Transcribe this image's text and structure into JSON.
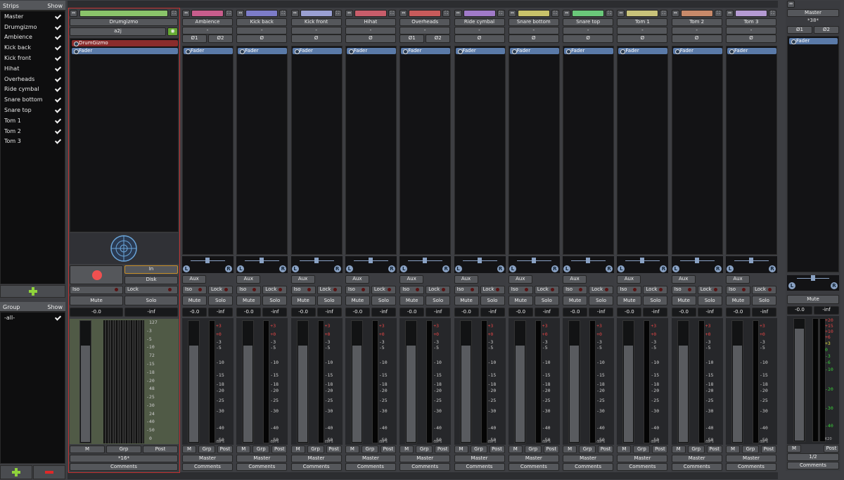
{
  "strips_panel": {
    "title": "Strips",
    "show_label": "Show",
    "items": [
      "Master",
      "Drumgizmo",
      "Ambience",
      "Kick back",
      "Kick front",
      "Hihat",
      "Overheads",
      "Ride cymbal",
      "Snare bottom",
      "Snare top",
      "Tom 1",
      "Tom 2",
      "Tom 3"
    ]
  },
  "group_panel": {
    "title": "Group",
    "show_label": "Show",
    "items": [
      "-all-"
    ]
  },
  "drumgizmo": {
    "name": "Drumgizmo",
    "input": "a2j",
    "plugins": [
      "DrumGizmo",
      "Fader"
    ],
    "in_label": "In",
    "disk_label": "Disk",
    "iso": "Iso",
    "lock": "Lock",
    "mute": "Mute",
    "solo": "Solo",
    "gain": "-0.0",
    "peak": "-inf",
    "m": "M",
    "grp": "Grp",
    "post": "Post",
    "output": "*16*",
    "comments": "Comments",
    "scale": [
      "127",
      "-3",
      "-5",
      "-10",
      "72",
      "-15",
      "-18",
      "-20",
      "48",
      "-25",
      "-30",
      "24",
      "-40",
      "-50",
      "0"
    ]
  },
  "strips": [
    {
      "name": "Ambience",
      "color": "#c85d8c",
      "phase": [
        "Ø1",
        "Ø2"
      ]
    },
    {
      "name": "Kick back",
      "color": "#7c7cc8",
      "phase": [
        "Ø"
      ]
    },
    {
      "name": "Kick front",
      "color": "#9aa0d2",
      "phase": [
        "Ø"
      ]
    },
    {
      "name": "Hihat",
      "color": "#c85d6a",
      "phase": [
        "Ø"
      ]
    },
    {
      "name": "Overheads",
      "color": "#c85b5b",
      "phase": [
        "Ø1",
        "Ø2"
      ]
    },
    {
      "name": "Ride cymbal",
      "color": "#a07ac8",
      "phase": [
        "Ø"
      ]
    },
    {
      "name": "Snare bottom",
      "color": "#c8c26a",
      "phase": [
        "Ø"
      ]
    },
    {
      "name": "Snare top",
      "color": "#6ac87a",
      "phase": [
        "Ø"
      ]
    },
    {
      "name": "Tom 1",
      "color": "#c8c27a",
      "phase": [
        "Ø"
      ]
    },
    {
      "name": "Tom 2",
      "color": "#c88a6a",
      "phase": [
        "Ø"
      ]
    },
    {
      "name": "Tom 3",
      "color": "#b49ad2",
      "phase": [
        "Ø"
      ]
    }
  ],
  "strip_common": {
    "input": "-",
    "fader": "Fader",
    "aux": "Aux",
    "iso": "Iso",
    "lock": "Lock",
    "mute": "Mute",
    "solo": "Solo",
    "gain": "-0.0",
    "peak": "-inf",
    "m": "M",
    "grp": "Grp",
    "post": "Post",
    "output": "Master",
    "comments": "Comments",
    "pan_l": "L",
    "pan_r": "R",
    "scale": [
      "+3",
      "+0",
      "-3",
      "-5",
      "-10",
      "-15",
      "-18",
      "-20",
      "-25",
      "-30",
      "-40",
      "-50"
    ],
    "dbfs": "dBFS"
  },
  "master": {
    "name": "Master",
    "output": "*38*",
    "phase": [
      "Ø1",
      "Ø2"
    ],
    "fader": "Fader",
    "pan_l": "L",
    "pan_r": "R",
    "mute": "Mute",
    "gain": "-0.0",
    "peak": "-inf",
    "m": "M",
    "post": "Post",
    "bus": "1/2",
    "comments": "Comments",
    "k20": "K20",
    "scale": [
      "+20",
      "+15",
      "+10",
      "+6",
      "+3",
      "0",
      "-3",
      "-6",
      "-10",
      "-20",
      "-30",
      "-40"
    ]
  },
  "icons": {
    "lock": "lock-icon",
    "add": "add-icon",
    "remove": "remove-icon"
  }
}
